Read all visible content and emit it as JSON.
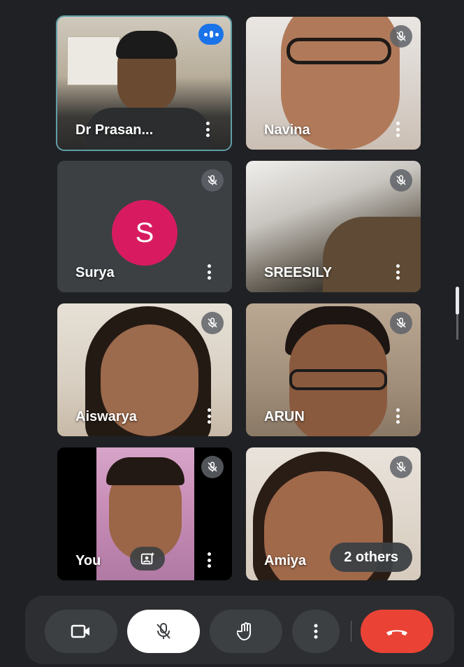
{
  "participants": [
    {
      "name": "Dr Prasan...",
      "speaking": true
    },
    {
      "name": "Navina",
      "muted": true
    },
    {
      "name": "Surya",
      "muted": true,
      "avatar_letter": "S",
      "avatar_color": "#d81b60"
    },
    {
      "name": "SREESILY",
      "muted": true
    },
    {
      "name": "Aiswarya",
      "muted": true
    },
    {
      "name": "ARUN",
      "muted": true
    },
    {
      "name": "You",
      "muted": true
    },
    {
      "name": "Amiya",
      "muted": true
    }
  ],
  "overflow_label": "2 others",
  "controls": {
    "camera": "camera-icon",
    "mic": "mic-off-icon",
    "raise_hand": "hand-icon",
    "more": "more-vert-icon",
    "end_call": "call-end-icon"
  },
  "colors": {
    "background": "#202124",
    "tile": "#3c4043",
    "active_border": "#5f9ea6",
    "end_call": "#ea4335",
    "speaking": "#1a73e8"
  }
}
